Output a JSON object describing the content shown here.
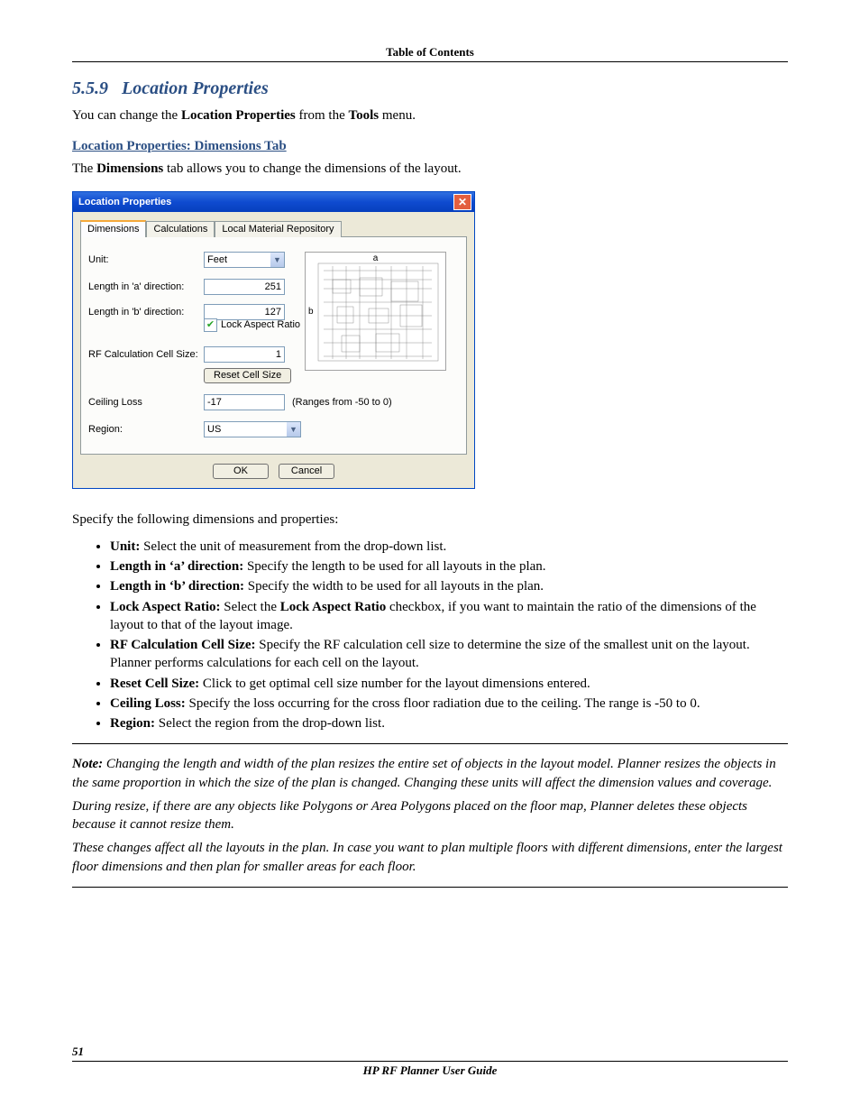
{
  "header": {
    "toc": "Table of Contents"
  },
  "section": {
    "number": "5.5.9",
    "title": "Location Properties",
    "intro_pre": "You can change the ",
    "intro_bold": "Location Properties",
    "intro_mid": " from the ",
    "intro_bold2": "Tools",
    "intro_post": " menu."
  },
  "sub": {
    "title": "Location Properties: Dimensions Tab",
    "para_pre": "The ",
    "para_bold": "Dimensions",
    "para_post": " tab allows you to change the dimensions of the layout."
  },
  "dialog": {
    "title": "Location Properties",
    "tabs": {
      "t1": "Dimensions",
      "t2": "Calculations",
      "t3": "Local Material Repository"
    },
    "labels": {
      "unit": "Unit:",
      "len_a": "Length in 'a' direction:",
      "len_b": "Length in 'b' direction:",
      "lock": "Lock Aspect Ratio",
      "rfcell": "RF Calculation Cell Size:",
      "reset": "Reset Cell Size",
      "ceil": "Ceiling Loss",
      "range": "(Ranges from -50 to 0)",
      "region": "Region:",
      "ok": "OK",
      "cancel": "Cancel",
      "a": "a",
      "b": "b"
    },
    "values": {
      "unit": "Feet",
      "len_a": "251",
      "len_b": "127",
      "rfcell": "1",
      "ceil": "-17",
      "region": "US"
    }
  },
  "list": {
    "intro": "Specify the following dimensions and properties:",
    "items": {
      "unit_b": "Unit:",
      "unit_t": " Select the unit of measurement from the drop-down list.",
      "lena_b": "Length in ‘a’ direction:",
      "lena_t": " Specify the length to be used for all layouts in the plan.",
      "lenb_b": "Length in ‘b’ direction:",
      "lenb_t": " Specify the width to be used for all layouts in the plan.",
      "lock_b": "Lock Aspect Ratio:",
      "lock_t1": " Select the ",
      "lock_b2": "Lock Aspect Ratio",
      "lock_t2": " checkbox, if you want to maintain the ratio of the dimensions of the layout to that of the layout image.",
      "rf_b": "RF Calculation Cell Size:",
      "rf_t": " Specify the RF calculation cell size to determine the size of the smallest unit on the layout. Planner performs calculations for each cell on the layout.",
      "reset_b": "Reset Cell Size:",
      "reset_t": " Click to get optimal cell size number for the layout dimensions entered.",
      "ceil_b": "Ceiling Loss:",
      "ceil_t": " Specify the loss occurring for the cross floor radiation due to the ceiling. The range is -50 to 0.",
      "reg_b": "Region:",
      "reg_t": " Select the region from the drop-down list."
    }
  },
  "note": {
    "label": "Note:",
    "p1": " Changing the length and width of the plan resizes the entire set of objects in the layout model. Planner resizes the objects in the same proportion in which the size of the plan is changed. Changing these units will affect the dimension values and coverage.",
    "p2": "During resize, if there are any objects like Polygons or Area Polygons placed on the floor map, Planner deletes these objects because it cannot resize them.",
    "p3": "These changes affect all the layouts in the plan. In case you want to plan multiple floors with different dimensions, enter the largest floor dimensions and then plan for smaller areas for each floor."
  },
  "footer": {
    "page": "51",
    "guide": "HP RF Planner User Guide"
  }
}
